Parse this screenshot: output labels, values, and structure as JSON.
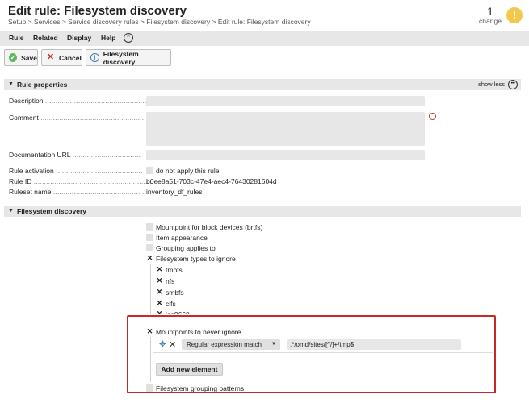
{
  "header": {
    "title": "Edit rule: Filesystem discovery",
    "breadcrumb": "Setup > Services > Service discovery rules > Filesystem discovery > Edit rule: Filesystem discovery",
    "change_count": "1",
    "change_label": "change",
    "warn_glyph": "!"
  },
  "menu": {
    "items": [
      "Rule",
      "Related",
      "Display",
      "Help"
    ],
    "toggle_glyph": "^"
  },
  "toolbar": {
    "save_label": "Save",
    "cancel_label": "Cancel",
    "fs_label": "Filesystem discovery"
  },
  "rule_properties": {
    "title": "Rule properties",
    "show_less": "show less",
    "description_label": "Description",
    "comment_label": "Comment",
    "doc_url_label": "Documentation URL",
    "activation_label": "Rule activation",
    "activation_checkbox": "do not apply this rule",
    "rule_id_label": "Rule ID",
    "rule_id_value": "b0ee8a51-703c-47e4-aec4-76430281604d",
    "ruleset_label": "Ruleset name",
    "ruleset_value": "inventory_df_rules"
  },
  "fs_section": {
    "title": "Filesystem discovery",
    "option_btrfs": "Mountpoint for block devices (brtfs)",
    "option_item_appearance": "Item appearance",
    "option_grouping_applies": "Grouping applies to",
    "option_types_ignore": "Filesystem types to ignore",
    "fs_types": [
      "tmpfs",
      "nfs",
      "smbfs",
      "cifs",
      "iso9660"
    ],
    "option_never_ignore": "Mountpoints to never ignore",
    "match_type": "Regular expression match",
    "regex_value": ".*/omd/sites/[^/]+/tmp$",
    "add_element": "Add new element",
    "option_grouping_patterns": "Filesystem grouping patterns"
  },
  "colors": {
    "highlight": "#c62828",
    "save_green": "#5cb85c",
    "warn_yellow": "#f2c94c"
  }
}
